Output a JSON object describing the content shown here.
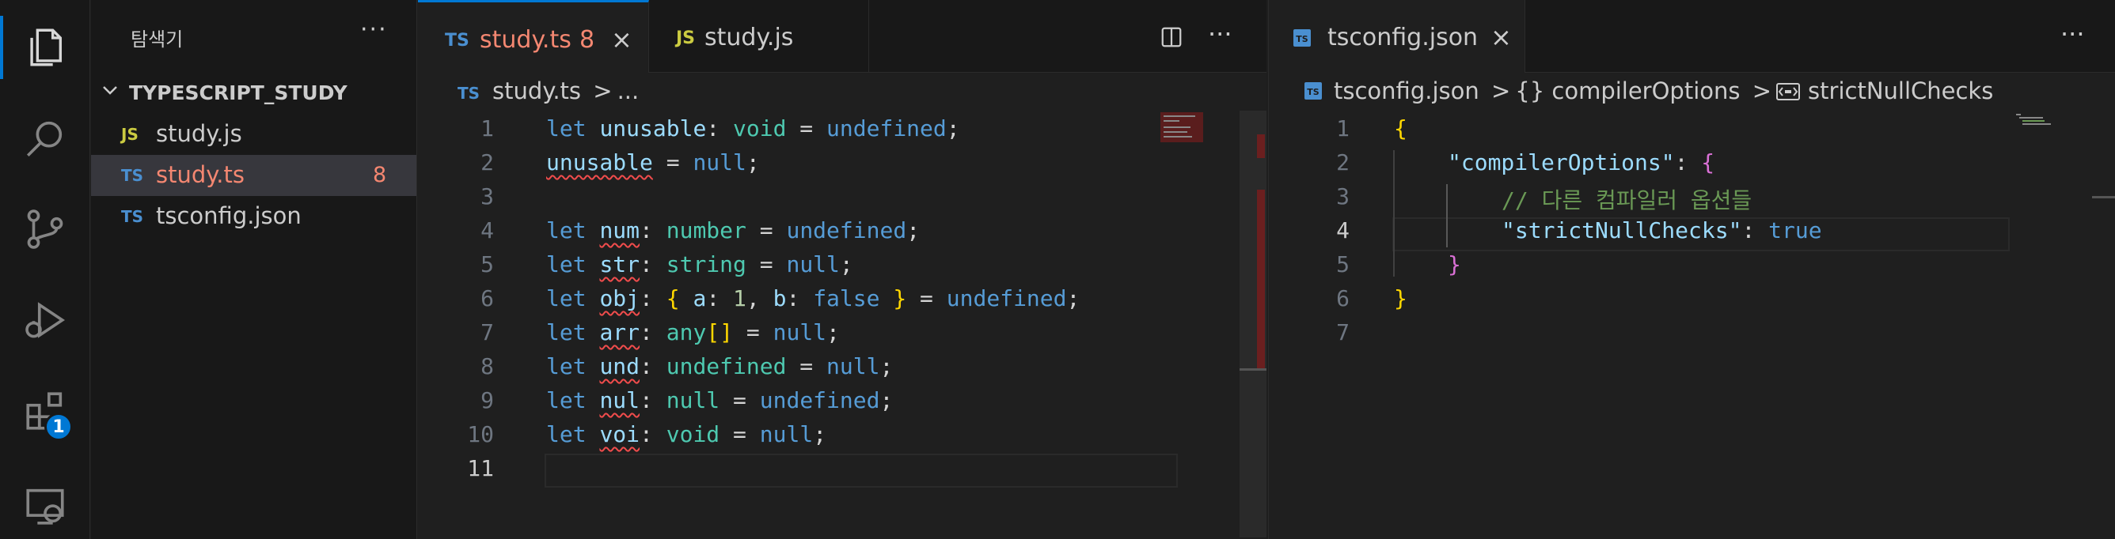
{
  "activity_bar": {
    "items": [
      {
        "name": "explorer-icon"
      },
      {
        "name": "search-icon"
      },
      {
        "name": "source-control-icon"
      },
      {
        "name": "run-debug-icon"
      },
      {
        "name": "extensions-icon"
      },
      {
        "name": "remote-explorer-icon"
      }
    ],
    "extensions_badge": "1"
  },
  "sidebar": {
    "title": "탐색기",
    "more": "···",
    "folder": "TYPESCRIPT_STUDY",
    "files": [
      {
        "icon": "JS",
        "name": "study.js",
        "count": ""
      },
      {
        "icon": "TS",
        "name": "study.ts",
        "count": "8"
      },
      {
        "icon": "TS",
        "name": "tsconfig.json",
        "count": ""
      }
    ]
  },
  "editor_left": {
    "tabs": [
      {
        "icon": "TS",
        "label": "study.ts",
        "problems": "8",
        "close": "×"
      },
      {
        "icon": "JS",
        "label": "study.js"
      }
    ],
    "actions": {
      "split": "split-editor-icon",
      "more": "···"
    },
    "breadcrumb": {
      "icon": "TS",
      "file": "study.ts",
      "sep": ">",
      "rest": "..."
    },
    "line_numbers": [
      "1",
      "2",
      "3",
      "4",
      "5",
      "6",
      "7",
      "8",
      "9",
      "10",
      "11"
    ],
    "current_line": "11"
  },
  "editor_right": {
    "tab": {
      "icon": "TS",
      "label": "tsconfig.json",
      "close": "×"
    },
    "more": "···",
    "breadcrumb": {
      "file": "tsconfig.json",
      "sep": ">",
      "obj": "{} compilerOptions",
      "prop": "strictNullChecks"
    },
    "line_numbers": [
      "1",
      "2",
      "3",
      "4",
      "5",
      "6",
      "7"
    ],
    "current_line": "4",
    "json": {
      "key_compiler_options": "\"compilerOptions\"",
      "comment": "// 다른 컴파일러 옵션들",
      "key_strict": "\"strictNullChecks\"",
      "value_strict": "true"
    }
  },
  "colors": {
    "accent": "#0078d4",
    "error": "#f14c4c",
    "modified_tab": "#f48771"
  }
}
